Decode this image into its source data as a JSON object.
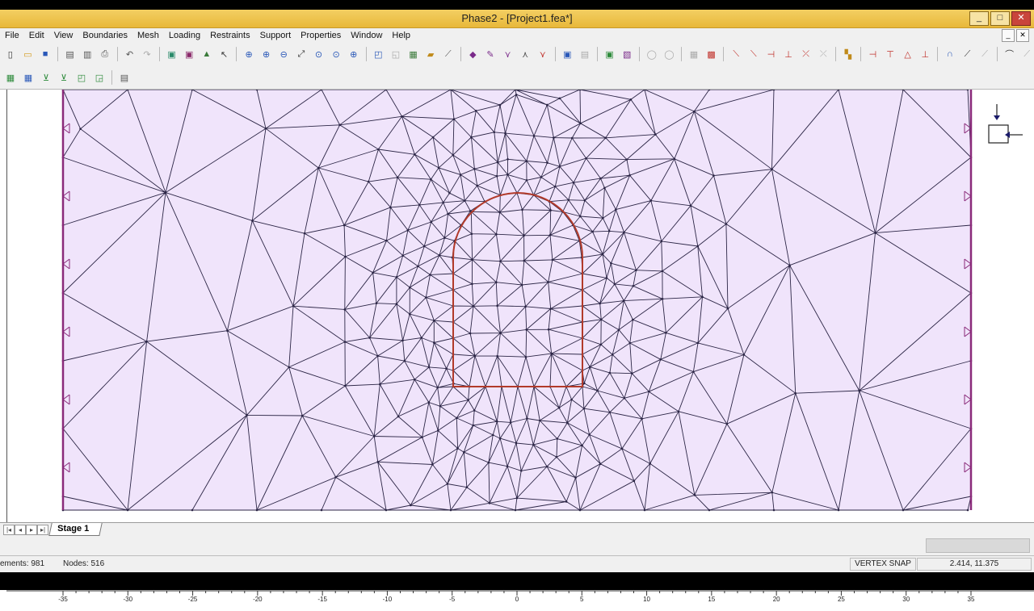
{
  "window": {
    "title": "Phase2 - [Project1.fea*]",
    "controls": {
      "minimize": "_",
      "maximize": "□",
      "close": "✕"
    }
  },
  "menu": [
    "File",
    "Edit",
    "View",
    "Boundaries",
    "Mesh",
    "Loading",
    "Restraints",
    "Support",
    "Properties",
    "Window",
    "Help"
  ],
  "toolbar1": [
    {
      "name": "new-icon",
      "glyph": "▯",
      "color": "#333"
    },
    {
      "name": "open-icon",
      "glyph": "▭",
      "color": "#d49a1a"
    },
    {
      "name": "save-icon",
      "glyph": "■",
      "color": "#2a58b8"
    },
    {
      "sep": true
    },
    {
      "name": "print-preview-icon",
      "glyph": "▤",
      "color": "#555"
    },
    {
      "name": "page-setup-icon",
      "glyph": "▥",
      "color": "#555"
    },
    {
      "name": "print-icon",
      "glyph": "⎙",
      "color": "#555"
    },
    {
      "sep": true
    },
    {
      "name": "undo-icon",
      "glyph": "↶",
      "color": "#555"
    },
    {
      "name": "redo-icon",
      "glyph": "↷",
      "color": "#aaa"
    },
    {
      "sep": true
    },
    {
      "name": "compute-icon",
      "glyph": "▣",
      "color": "#2a8a6a"
    },
    {
      "name": "interpret-icon",
      "glyph": "▣",
      "color": "#8a2a6a"
    },
    {
      "name": "tools-icon",
      "glyph": "▲",
      "color": "#3a7a3a"
    },
    {
      "name": "select-icon",
      "glyph": "↖",
      "color": "#333"
    },
    {
      "sep": true
    },
    {
      "name": "zoom-all-icon",
      "glyph": "⊕",
      "color": "#2a58b8"
    },
    {
      "name": "zoom-in-icon",
      "glyph": "⊕",
      "color": "#2a58b8"
    },
    {
      "name": "zoom-out-icon",
      "glyph": "⊖",
      "color": "#2a58b8"
    },
    {
      "name": "zoom-window-icon",
      "glyph": "⤢",
      "color": "#333"
    },
    {
      "name": "zoom-excavation-icon",
      "glyph": "⊙",
      "color": "#2a58b8"
    },
    {
      "name": "zoom-previous-icon",
      "glyph": "⊙",
      "color": "#2a58b8"
    },
    {
      "name": "pan-icon",
      "glyph": "⊕",
      "color": "#2a58b8"
    },
    {
      "sep": true
    },
    {
      "name": "add-external-icon",
      "glyph": "◰",
      "color": "#2a58b8"
    },
    {
      "name": "add-excavation-icon",
      "glyph": "◱",
      "color": "#aaa"
    },
    {
      "name": "add-boundary-icon",
      "glyph": "▦",
      "color": "#3a7a3a"
    },
    {
      "name": "add-stage-boundary-icon",
      "glyph": "▰",
      "color": "#c08a1a"
    },
    {
      "name": "add-joint-icon",
      "glyph": "⟋",
      "color": "#555"
    },
    {
      "sep": true
    },
    {
      "name": "discretize-icon",
      "glyph": "◆",
      "color": "#7a2a8a"
    },
    {
      "name": "mesh-setup-icon",
      "glyph": "✎",
      "color": "#7a2a8a"
    },
    {
      "name": "mesh-icon",
      "glyph": "⋎",
      "color": "#7a2a8a"
    },
    {
      "name": "vertex-icon",
      "glyph": "⋏",
      "color": "#555"
    },
    {
      "name": "edit-mesh-icon",
      "glyph": "⋎",
      "color": "#c0302a"
    },
    {
      "sep": true
    },
    {
      "name": "field-stress-icon",
      "glyph": "▣",
      "color": "#2a58b8"
    },
    {
      "name": "loading-icon",
      "glyph": "▤",
      "color": "#aaa"
    },
    {
      "sep": true
    },
    {
      "name": "properties-icon",
      "glyph": "▣",
      "color": "#2c8a3a"
    },
    {
      "name": "assign-properties-icon",
      "glyph": "▧",
      "color": "#7a2a8a"
    },
    {
      "sep": true
    },
    {
      "name": "excavate-icon",
      "glyph": "◯",
      "color": "#aaa"
    },
    {
      "name": "fill-icon",
      "glyph": "◯",
      "color": "#aaa"
    },
    {
      "sep": true
    },
    {
      "name": "grid-icon",
      "glyph": "▦",
      "color": "#aaa"
    },
    {
      "name": "support-icon",
      "glyph": "▩",
      "color": "#c0302a"
    },
    {
      "sep": true
    },
    {
      "name": "bolt-icon",
      "glyph": "⟍",
      "color": "#c0302a"
    },
    {
      "name": "liner-icon",
      "glyph": "⟍",
      "color": "#c0302a"
    },
    {
      "name": "restrain-x-icon",
      "glyph": "⊣",
      "color": "#c0302a"
    },
    {
      "name": "restrain-y-icon",
      "glyph": "⊥",
      "color": "#c0302a"
    },
    {
      "name": "restrain-xy-icon",
      "glyph": "⤫",
      "color": "#c0302a"
    },
    {
      "name": "free-icon",
      "glyph": "⤫",
      "color": "#aaa"
    },
    {
      "sep": true
    },
    {
      "name": "material-icon",
      "glyph": "▚",
      "color": "#c08a1a"
    },
    {
      "sep": true
    },
    {
      "name": "query-x-icon",
      "glyph": "⊣",
      "color": "#c0302a"
    },
    {
      "name": "query-y-icon",
      "glyph": "⊤",
      "color": "#c0302a"
    },
    {
      "name": "query-triangle-icon",
      "glyph": "△",
      "color": "#c0302a"
    },
    {
      "name": "query-icon",
      "glyph": "⊥",
      "color": "#c0302a"
    },
    {
      "sep": true
    },
    {
      "name": "arch-icon",
      "glyph": "∩",
      "color": "#2a58b8"
    },
    {
      "name": "draw-line-icon",
      "glyph": "⟋",
      "color": "#333"
    },
    {
      "name": "draw-polyline-icon",
      "glyph": "⟋",
      "color": "#aaa"
    },
    {
      "sep": true
    },
    {
      "name": "arc-icon",
      "glyph": "⌒",
      "color": "#333"
    },
    {
      "name": "ruler-icon",
      "glyph": "⟋",
      "color": "#aaa"
    }
  ],
  "toolbar2": [
    {
      "name": "material-table-icon",
      "glyph": "▦",
      "color": "#2c8a3a"
    },
    {
      "name": "info-table-icon",
      "glyph": "▦",
      "color": "#2a58b8"
    },
    {
      "name": "filter-icon",
      "glyph": "⊻",
      "color": "#2c8a3a"
    },
    {
      "name": "filter-edit-icon",
      "glyph": "⊻",
      "color": "#2c8a3a"
    },
    {
      "name": "layers-icon",
      "glyph": "◰",
      "color": "#2c8a3a"
    },
    {
      "name": "display-options-icon",
      "glyph": "◲",
      "color": "#2c8a3a"
    },
    {
      "sep": true
    },
    {
      "name": "export-icon",
      "glyph": "▤",
      "color": "#555"
    }
  ],
  "canvas": {
    "mesh_fill": "#f0e4fb",
    "mesh_line": "#2c2646",
    "boundary_color": "#8a2a7a",
    "excavation_color": "#b23a2a"
  },
  "xaxis": {
    "ticks": [
      "-35",
      "-30",
      "-25",
      "-20",
      "-15",
      "-10",
      "-5",
      "0",
      "5",
      "10",
      "15",
      "20",
      "25",
      "30",
      "35"
    ]
  },
  "stage_tab": "Stage 1",
  "status": {
    "elements": "ements: 981",
    "nodes": "Nodes: 516",
    "snap": "VERTEX SNAP",
    "coords": "2.414,  11.375"
  }
}
